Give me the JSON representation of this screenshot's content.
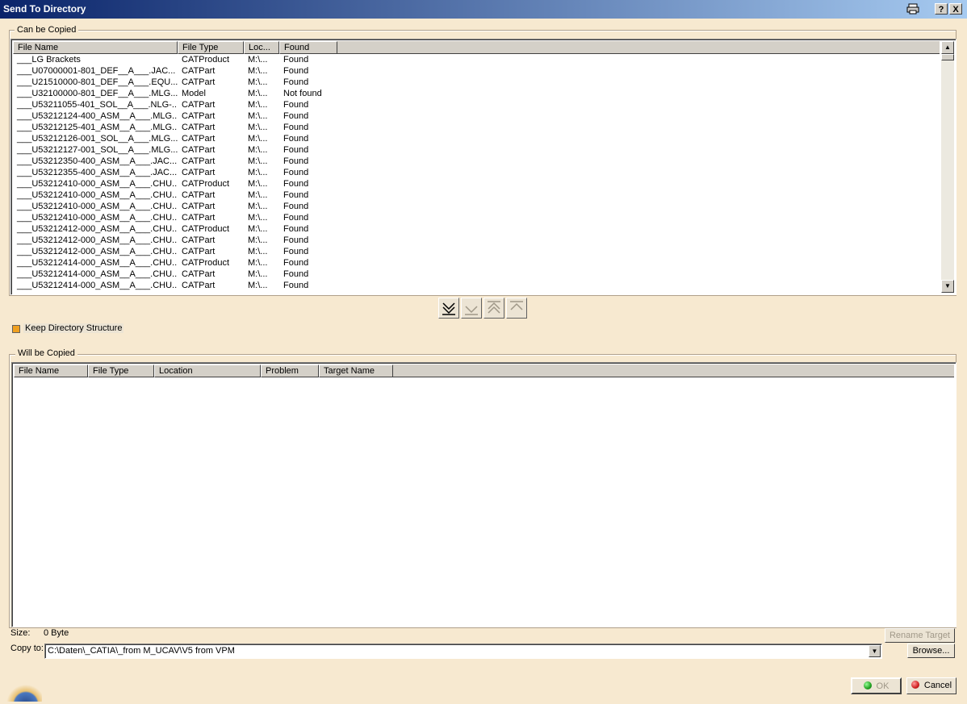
{
  "window": {
    "title": "Send To Directory",
    "help_label": "?",
    "close_label": "X"
  },
  "can_be_copied": {
    "label": "Can be Copied",
    "columns": [
      "File Name",
      "File Type",
      "Loc...",
      "Found"
    ],
    "rows": [
      [
        "___LG Brackets",
        "CATProduct",
        "M:\\...",
        "Found"
      ],
      [
        "___U07000001-801_DEF__A___.JAC...",
        "CATPart",
        "M:\\...",
        "Found"
      ],
      [
        "___U21510000-801_DEF__A___.EQU...",
        "CATPart",
        "M:\\...",
        "Found"
      ],
      [
        "___U32100000-801_DEF__A___.MLG...",
        "Model",
        "M:\\...",
        "Not found"
      ],
      [
        "___U53211055-401_SOL__A___.NLG-...",
        "CATPart",
        "M:\\...",
        "Found"
      ],
      [
        "___U53212124-400_ASM__A___.MLG...",
        "CATPart",
        "M:\\...",
        "Found"
      ],
      [
        "___U53212125-401_ASM__A___.MLG...",
        "CATPart",
        "M:\\...",
        "Found"
      ],
      [
        "___U53212126-001_SOL__A___.MLG...",
        "CATPart",
        "M:\\...",
        "Found"
      ],
      [
        "___U53212127-001_SOL__A___.MLG...",
        "CATPart",
        "M:\\...",
        "Found"
      ],
      [
        "___U53212350-400_ASM__A___.JAC...",
        "CATPart",
        "M:\\...",
        "Found"
      ],
      [
        "___U53212355-400_ASM__A___.JAC...",
        "CATPart",
        "M:\\...",
        "Found"
      ],
      [
        "___U53212410-000_ASM__A___.CHU...",
        "CATProduct",
        "M:\\...",
        "Found"
      ],
      [
        "___U53212410-000_ASM__A___.CHU...",
        "CATPart",
        "M:\\...",
        "Found"
      ],
      [
        "___U53212410-000_ASM__A___.CHU...",
        "CATPart",
        "M:\\...",
        "Found"
      ],
      [
        "___U53212410-000_ASM__A___.CHU...",
        "CATPart",
        "M:\\...",
        "Found"
      ],
      [
        "___U53212412-000_ASM__A___.CHU...",
        "CATProduct",
        "M:\\...",
        "Found"
      ],
      [
        "___U53212412-000_ASM__A___.CHU...",
        "CATPart",
        "M:\\...",
        "Found"
      ],
      [
        "___U53212412-000_ASM__A___.CHU...",
        "CATPart",
        "M:\\...",
        "Found"
      ],
      [
        "___U53212414-000_ASM__A___.CHU...",
        "CATProduct",
        "M:\\...",
        "Found"
      ],
      [
        "___U53212414-000_ASM__A___.CHU...",
        "CATPart",
        "M:\\...",
        "Found"
      ],
      [
        "___U53212414-000_ASM__A___.CHU...",
        "CATPart",
        "M:\\...",
        "Found"
      ]
    ]
  },
  "keep_structure": {
    "label": "Keep Directory Structure",
    "checked": true
  },
  "will_be_copied": {
    "label": "Will be Copied",
    "columns": [
      "File Name",
      "File Type",
      "Location",
      "Problem",
      "Target Name"
    ]
  },
  "size": {
    "label": "Size:",
    "value": "0 Byte"
  },
  "rename_target_label": "Rename Target",
  "copy_to": {
    "label": "Copy to:",
    "value": "C:\\Daten\\_CATIA\\_from M_UCAV\\V5 from VPM"
  },
  "browse_label": "Browse...",
  "ok_label": "OK",
  "cancel_label": "Cancel",
  "colors": {
    "title_start": "#0a246a",
    "title_end": "#a6caf0",
    "ok_icon": "#20a020",
    "cancel_icon": "#d02020"
  }
}
